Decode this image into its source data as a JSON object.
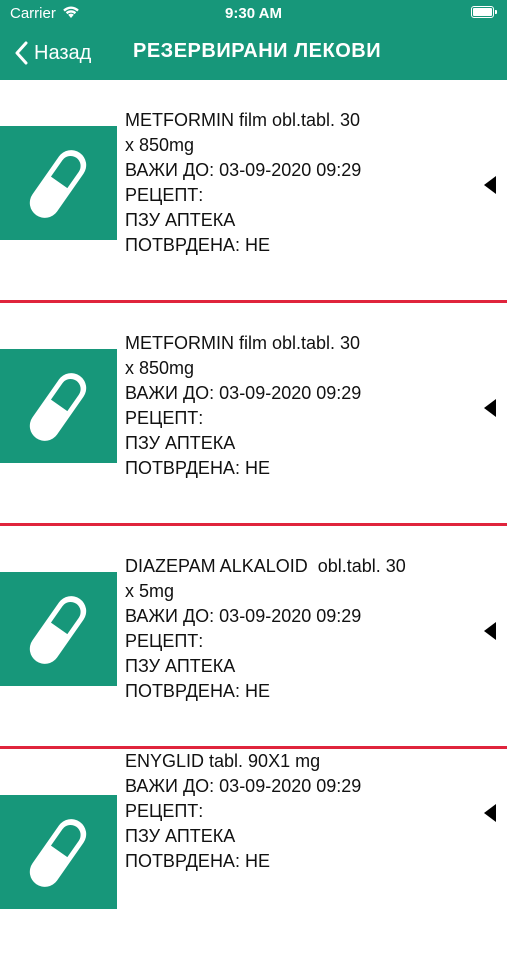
{
  "status_bar": {
    "carrier": "Carrier",
    "time": "9:30 AM"
  },
  "nav": {
    "back_label": "Назад",
    "title": "РЕЗЕРВИРАНИ ЛЕКОВИ"
  },
  "colors": {
    "primary": "#17977a",
    "divider": "#e0243c"
  },
  "items": [
    {
      "name_line1": "METFORMIN film obl.tabl. 30",
      "name_line2": "x 850mg",
      "valid_until": "ВАЖИ ДО: 03-09-2020 09:29",
      "prescription": "РЕЦЕПТ:",
      "pharmacy": "ПЗУ АПТЕКА",
      "confirmed": "ПОТВРДЕНА: НЕ",
      "icon": "pill-icon"
    },
    {
      "name_line1": "METFORMIN film obl.tabl. 30",
      "name_line2": "x 850mg",
      "valid_until": "ВАЖИ ДО: 03-09-2020 09:29",
      "prescription": "РЕЦЕПТ:",
      "pharmacy": "ПЗУ АПТЕКА",
      "confirmed": "ПОТВРДЕНА: НЕ",
      "icon": "pill-icon"
    },
    {
      "name_line1": "DIAZEPAM ALKALOID  obl.tabl. 30",
      "name_line2": "x 5mg",
      "valid_until": "ВАЖИ ДО: 03-09-2020 09:29",
      "prescription": "РЕЦЕПТ:",
      "pharmacy": "ПЗУ АПТЕКА",
      "confirmed": "ПОТВРДЕНА: НЕ",
      "icon": "pill-icon"
    },
    {
      "name_line1": "ENYGLID tabl. 90X1 mg",
      "name_line2": "",
      "valid_until": "ВАЖИ ДО: 03-09-2020 09:29",
      "prescription": "РЕЦЕПТ:",
      "pharmacy": "ПЗУ АПТЕКА",
      "confirmed": "ПОТВРДЕНА: НЕ",
      "icon": "pill-icon"
    }
  ]
}
